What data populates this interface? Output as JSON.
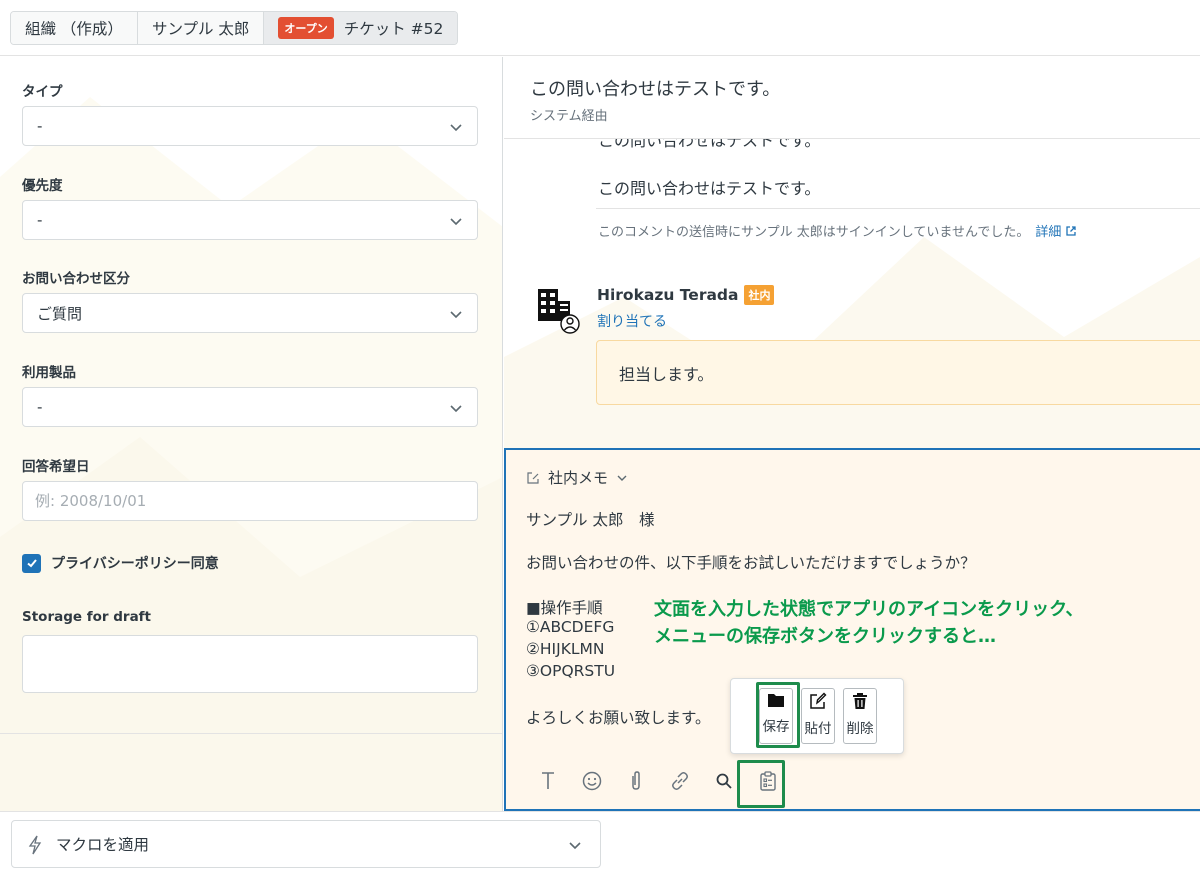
{
  "breadcrumb": {
    "tabs": [
      {
        "label": "組織 （作成）"
      },
      {
        "label": "サンプル 太郎"
      },
      {
        "badge": "オープン",
        "label": "チケット #52"
      }
    ]
  },
  "sidebar": {
    "type": {
      "label": "タイプ",
      "value": "-"
    },
    "priority": {
      "label": "優先度",
      "value": "-"
    },
    "category": {
      "label": "お問い合わせ区分",
      "value": "ご質問"
    },
    "product": {
      "label": "利用製品",
      "value": "-"
    },
    "due_date": {
      "label": "回答希望日",
      "placeholder": "例: 2008/10/01"
    },
    "privacy": {
      "label": "プライバシーポリシー同意",
      "checked": true
    },
    "storage": {
      "label": "Storage for draft",
      "value": ""
    }
  },
  "conversation": {
    "title": "この問い合わせはテストです。",
    "via": "システム経由",
    "cutoff_text": "この問い合わせはテストです。",
    "message_text": "この問い合わせはテストです。",
    "notice": "このコメントの送信時にサンプル 太郎はサインインしていませんでした。",
    "notice_link": "詳細",
    "comment": {
      "author": "Hirokazu Terada",
      "tag": "社内",
      "assign_link": "割り当てる",
      "body": "担当します。"
    }
  },
  "editor": {
    "mode_label": "社内メモ",
    "lines": [
      "サンプル 太郎　様",
      "お問い合わせの件、以下手順をお試しいただけますでしょうか？",
      "■操作手順",
      "①ABCDEFG",
      "②HIJKLMN",
      "③OPQRSTU",
      "よろしくお願い致します。"
    ],
    "annotation": [
      "文面を入力した状態でアプリのアイコンをクリック、",
      "メニューの保存ボタンをクリックすると…"
    ],
    "popup": {
      "save": "保存",
      "paste": "貼付",
      "delete": "削除"
    },
    "toolbar_icons": [
      "text-format-icon",
      "emoji-icon",
      "attachment-icon",
      "link-icon",
      "search-icon",
      "app-clipboard-icon"
    ],
    "highlight_color": "#1e8c4c",
    "annotation_color": "#0a9a4c"
  },
  "footer": {
    "macro_label": "マクロを適用"
  },
  "colors": {
    "accent": "#1f73b7",
    "open_badge": "#e34f32",
    "internal_tag": "#f5a133",
    "memo_bg": "#fff7ec"
  }
}
